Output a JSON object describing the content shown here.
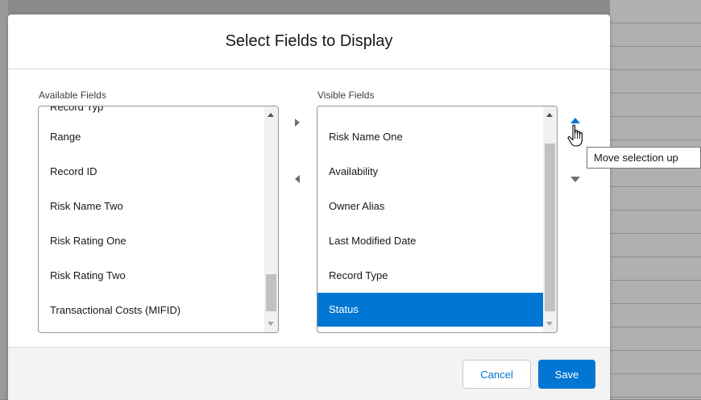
{
  "modal": {
    "title": "Select Fields to Display"
  },
  "available": {
    "label": "Available Fields",
    "partial_item": "Record Typ",
    "items": [
      "Range",
      "Record ID",
      "Risk Name Two",
      "Risk Rating One",
      "Risk Rating Two",
      "Transactional Costs (MIFID)"
    ]
  },
  "visible": {
    "label": "Visible Fields",
    "items": [
      "Risk Name One",
      "Availability",
      "Owner Alias",
      "Last Modified Date",
      "Record Type",
      "Status"
    ],
    "selected": "Status"
  },
  "controls": {
    "move_right_icon": "triangle-right-icon",
    "move_left_icon": "triangle-left-icon",
    "move_up_icon": "triangle-up-icon",
    "move_down_icon": "triangle-down-icon"
  },
  "tooltip": {
    "text": "Move selection up"
  },
  "footer": {
    "cancel_label": "Cancel",
    "save_label": "Save"
  },
  "colors": {
    "brand": "#0176d3",
    "selected_bg": "#0176d3",
    "footer_bg": "#f3f3f3"
  }
}
